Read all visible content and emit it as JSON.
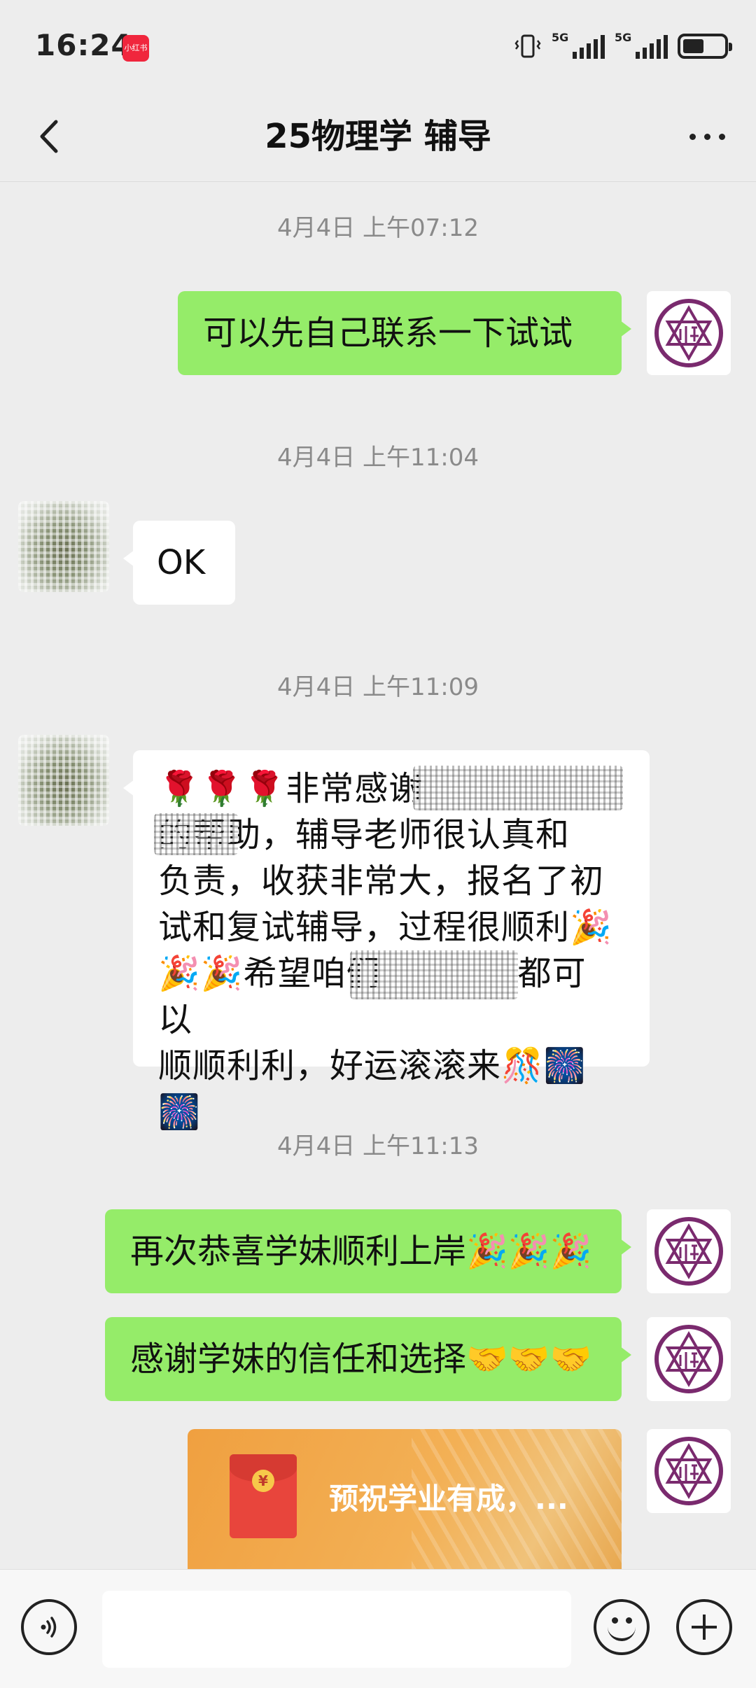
{
  "status_bar": {
    "time": "16:24",
    "app_badge": "小红书",
    "network_1": "5G",
    "network_2": "5G",
    "battery_level": 0.45
  },
  "nav": {
    "title": "25物理学 辅导"
  },
  "messages": [
    {
      "type": "timestamp",
      "text": "4月4日 上午07:12"
    },
    {
      "type": "text",
      "from": "me",
      "text": "可以先自己联系一下试试"
    },
    {
      "type": "timestamp",
      "text": "4月4日 上午11:04"
    },
    {
      "type": "text",
      "from": "other",
      "text": "OK"
    },
    {
      "type": "timestamp",
      "text": "4月4日 上午11:09"
    },
    {
      "type": "text",
      "from": "other",
      "text": "🌹🌹🌹非常感谢\n的帮助，辅导老师很认真和\n负责，收获非常大，报名了初\n试和复试辅导，过程很顺利🎉\n🎉🎉希望咱们　　　　都可以\n顺顺利利，好运滚滚来🎊🎆🎆"
    },
    {
      "type": "timestamp",
      "text": "4月4日 上午11:13"
    },
    {
      "type": "text",
      "from": "me",
      "text": "再次恭喜学妹顺利上岸🎉🎉🎉"
    },
    {
      "type": "text",
      "from": "me",
      "text": "感谢学妹的信任和选择🤝🤝🤝"
    },
    {
      "type": "red_packet",
      "from": "me",
      "text": "预祝学业有成，...",
      "coin": "¥"
    }
  ],
  "icons": {
    "back": "chevron-left-icon",
    "more": "more-dots-icon",
    "voice": "voice-icon",
    "emoji": "emoji-icon",
    "plus": "plus-icon"
  },
  "colors": {
    "background": "#ededed",
    "my_bubble": "#95ec69",
    "other_bubble": "#ffffff",
    "timestamp": "#8a8a8a",
    "avatar_purple": "#7a2a6e"
  }
}
